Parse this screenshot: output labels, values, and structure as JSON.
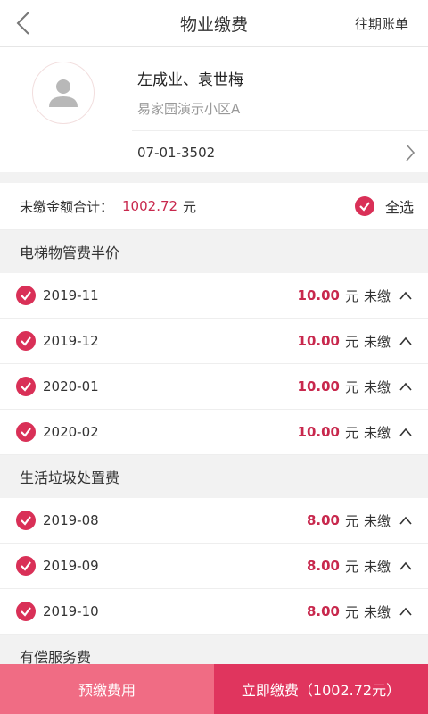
{
  "nav": {
    "title": "物业缴费",
    "history": "往期账单"
  },
  "profile": {
    "owner": "左成业、袁世梅",
    "community": "易家园演示小区A",
    "room": "07-01-3502"
  },
  "summary": {
    "label": "未缴金额合计：",
    "amount": "1002.72",
    "unit": "元",
    "select_all": "全选"
  },
  "sections": [
    {
      "title": "电梯物管费半价",
      "rows": [
        {
          "period": "2019-11",
          "amount": "10.00",
          "unit": "元",
          "status": "未缴"
        },
        {
          "period": "2019-12",
          "amount": "10.00",
          "unit": "元",
          "status": "未缴"
        },
        {
          "period": "2020-01",
          "amount": "10.00",
          "unit": "元",
          "status": "未缴"
        },
        {
          "period": "2020-02",
          "amount": "10.00",
          "unit": "元",
          "status": "未缴"
        }
      ]
    },
    {
      "title": "生活垃圾处置费",
      "rows": [
        {
          "period": "2019-08",
          "amount": "8.00",
          "unit": "元",
          "status": "未缴"
        },
        {
          "period": "2019-09",
          "amount": "8.00",
          "unit": "元",
          "status": "未缴"
        },
        {
          "period": "2019-10",
          "amount": "8.00",
          "unit": "元",
          "status": "未缴"
        }
      ]
    },
    {
      "title": "有偿服务费",
      "rows": []
    }
  ],
  "bottom": {
    "prepay": "预缴费用",
    "pay_now": "立即缴费（1002.72元）"
  },
  "colors": {
    "accent": "#d93057",
    "amount": "#c8284d",
    "prepay_bg": "#f06c84",
    "pay_bg": "#e0355e"
  },
  "icons": {
    "back": "chevron-left-icon",
    "room_arrow": "chevron-right-icon",
    "check": "check-circle-icon",
    "collapse": "chevron-up-icon",
    "avatar": "user-icon"
  }
}
